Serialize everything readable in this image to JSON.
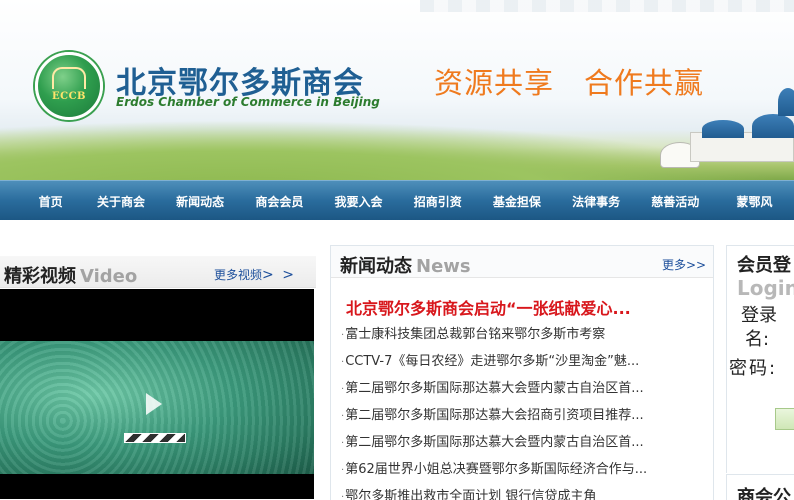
{
  "header": {
    "logo_abbr": "ECCB",
    "site_title": "北京鄂尔多斯商会",
    "site_title_en": "Erdos Chamber of Commerce in Beijing",
    "slogan_1": "资源共享",
    "slogan_2": "合作共赢"
  },
  "nav": {
    "items": [
      {
        "label": "首页"
      },
      {
        "label": "关于商会"
      },
      {
        "label": "新闻动态"
      },
      {
        "label": "商会会员"
      },
      {
        "label": "我要入会"
      },
      {
        "label": "招商引资"
      },
      {
        "label": "基金担保"
      },
      {
        "label": "法律事务"
      },
      {
        "label": "慈善活动"
      },
      {
        "label": "蒙鄂风"
      }
    ]
  },
  "video": {
    "title": "精彩视频",
    "title_en": "Video",
    "more": "更多视频",
    "more_arrows": "> >"
  },
  "news": {
    "title": "新闻动态",
    "title_en": "News",
    "more": "更多>>",
    "headline": "北京鄂尔多斯商会启动“一张纸献爱心...",
    "items": [
      {
        "text": "富士康科技集团总裁郭台铭来鄂尔多斯市考察"
      },
      {
        "text": "CCTV-7《每日农经》走进鄂尔多斯“沙里淘金”魅..."
      },
      {
        "text": "第二届鄂尔多斯国际那达慕大会暨内蒙古自治区首..."
      },
      {
        "text": "第二届鄂尔多斯国际那达慕大会招商引资项目推荐..."
      },
      {
        "text": "第二届鄂尔多斯国际那达慕大会暨内蒙古自治区首..."
      },
      {
        "text": "第62届世界小姐总决赛暨鄂尔多斯国际经济合作与..."
      },
      {
        "text": "鄂尔多斯推出救市全面计划 银行信贷成主角"
      }
    ]
  },
  "login": {
    "title": "会员登",
    "subtitle": "Login",
    "user_label_1": "登录",
    "user_label_2": "名:",
    "password_label": "密码:"
  },
  "notice": {
    "title": "商会公"
  }
}
